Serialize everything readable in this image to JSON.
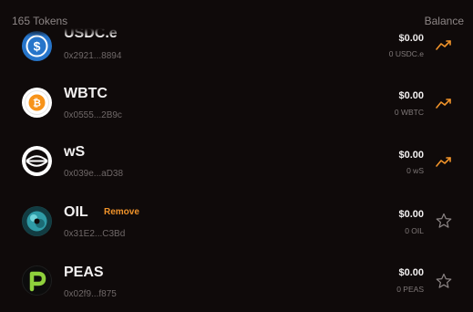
{
  "header": {
    "token_count": "165 Tokens",
    "balance_label": "Balance"
  },
  "tokens": [
    {
      "symbol": "USDC.e",
      "address": "0x2921...8894",
      "value": "$0.00",
      "amount": "0 USDC.e",
      "action": "trending-icon"
    },
    {
      "symbol": "WBTC",
      "address": "0x0555...2B9c",
      "value": "$0.00",
      "amount": "0 WBTC",
      "action": "trending-icon"
    },
    {
      "symbol": "wS",
      "address": "0x039e...aD38",
      "value": "$0.00",
      "amount": "0 wS",
      "action": "trending-icon"
    },
    {
      "symbol": "OIL",
      "remove_label": "Remove",
      "address": "0x31E2...C3Bd",
      "value": "$0.00",
      "amount": "0 OIL",
      "action": "star-icon"
    },
    {
      "symbol": "PEAS",
      "address": "0x02f9...f875",
      "value": "$0.00",
      "amount": "0 PEAS",
      "action": "star-icon"
    }
  ],
  "colors": {
    "background": "#0f0a0a",
    "accent": "#f0932a",
    "usdc": "#2775ca",
    "wbtc": "#f7931a",
    "peas": "#8fd13c"
  }
}
